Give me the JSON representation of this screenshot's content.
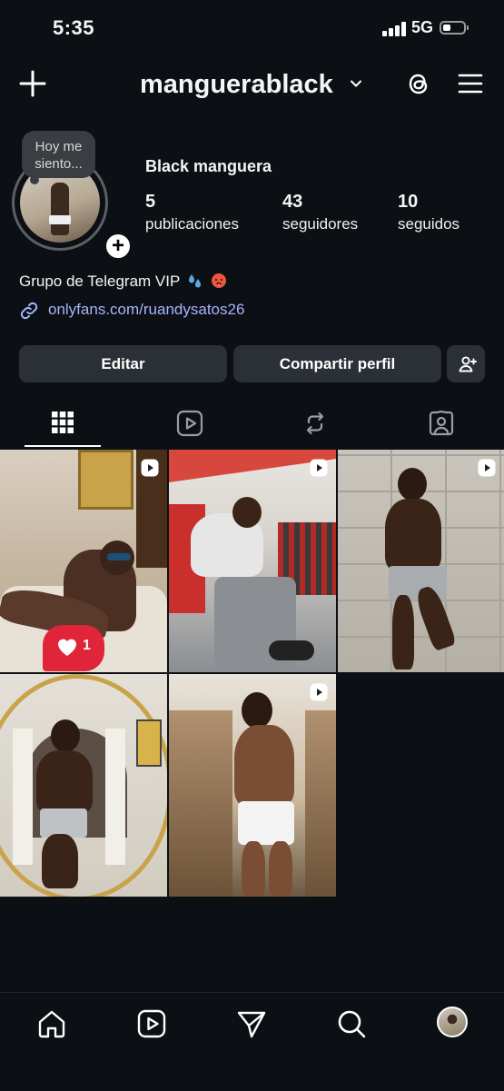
{
  "status_bar": {
    "time": "5:35",
    "network": "5G",
    "battery_level": 0.25
  },
  "header": {
    "username": "manguerablack",
    "icons": [
      "plus-icon",
      "chevron-down-icon",
      "threads-icon",
      "menu-icon"
    ]
  },
  "profile": {
    "note": "Hoy me siento...",
    "display_name": "Black manguera",
    "stats": [
      {
        "count": "5",
        "label": "publicaciones"
      },
      {
        "count": "43",
        "label": "seguidores"
      },
      {
        "count": "10",
        "label": "seguidos"
      }
    ],
    "bio": "Grupo de Telegram VIP",
    "bio_emojis": [
      "sweat-droplets-emoji",
      "hot-face-emoji"
    ],
    "link": "onlyfans.com/ruandysatos26"
  },
  "buttons": {
    "edit": "Editar",
    "share": "Compartir perfil",
    "add_person_icon": "add-person-icon"
  },
  "tabs": [
    {
      "name": "posts",
      "icon": "grid-icon",
      "active": true
    },
    {
      "name": "reels",
      "icon": "reels-icon",
      "active": false
    },
    {
      "name": "reposts",
      "icon": "repost-icon",
      "active": false
    },
    {
      "name": "tagged",
      "icon": "tagged-icon",
      "active": false
    }
  ],
  "posts": [
    {
      "type": "reel",
      "description": "man reclining on sofa with sunglasses"
    },
    {
      "type": "reel",
      "description": "man sitting in red gym"
    },
    {
      "type": "reel",
      "description": "man standing against stone wall"
    },
    {
      "type": "reel",
      "description": "mirror selfie"
    },
    {
      "type": "reel",
      "description": "man standing by window"
    }
  ],
  "activity_notification": {
    "icon": "heart-icon",
    "count": "1"
  },
  "bottom_nav": [
    "home-icon",
    "reels-icon",
    "send-icon",
    "search-icon",
    "profile-avatar"
  ],
  "colors": {
    "background": "#0c1014",
    "button": "#2b3036",
    "link": "#a5b3ff",
    "notification": "#e0243a"
  }
}
